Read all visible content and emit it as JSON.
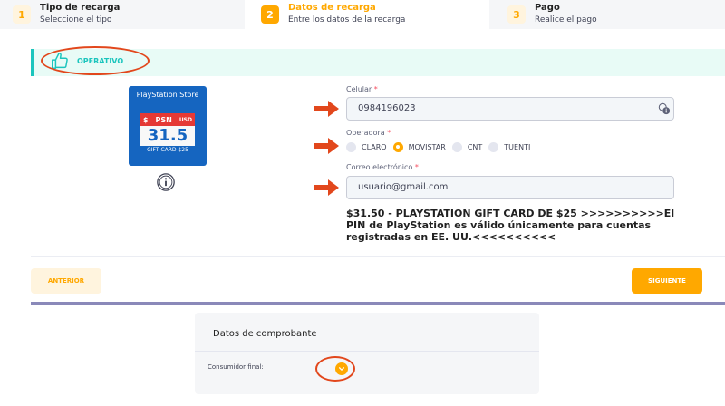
{
  "steps": [
    {
      "num": "1",
      "title": "Tipo de recarga",
      "subtitle": "Seleccione el tipo",
      "state": "done"
    },
    {
      "num": "2",
      "title": "Datos de recarga",
      "subtitle": "Entre los datos de la recarga",
      "state": "active"
    },
    {
      "num": "3",
      "title": "Pago",
      "subtitle": "Realice el pago",
      "state": "pending"
    }
  ],
  "status": {
    "label": "OPERATIVO",
    "icon": "thumbs-up-icon",
    "color": "#1bc5bd"
  },
  "product": {
    "store": "PlayStation Store",
    "brand": "PSN",
    "currency_symbol": "$",
    "currency_code": "USD",
    "amount": "31.5",
    "caption": "GIFT CARD $25",
    "info_icon": "info-icon"
  },
  "form": {
    "phone": {
      "label": "Celular",
      "required_mark": "*",
      "value": "0984196023"
    },
    "operator": {
      "label": "Operadora",
      "required_mark": "*",
      "options": [
        "CLARO",
        "MOVISTAR",
        "CNT",
        "TUENTI"
      ],
      "selected": "MOVISTAR"
    },
    "email": {
      "label": "Correo electrónico",
      "required_mark": "*",
      "value": "usuario@gmail.com"
    }
  },
  "description": "$31.50 - PLAYSTATION GIFT CARD DE $25 >>>>>>>>>>El PIN de PlayStation es válido únicamente para cuentas registradas en EE. UU.<<<<<<<<<<",
  "buttons": {
    "previous": "ANTERIOR",
    "next": "SIGUIENTE"
  },
  "voucher": {
    "title": "Datos de comprobante",
    "field_label": "Consumidor final:",
    "toggle_icon": "chevron-down-icon"
  },
  "colors": {
    "accent": "#ffa800",
    "success": "#1bc5bd",
    "annotation": "#e2471c",
    "divider": "#8a89b9"
  }
}
